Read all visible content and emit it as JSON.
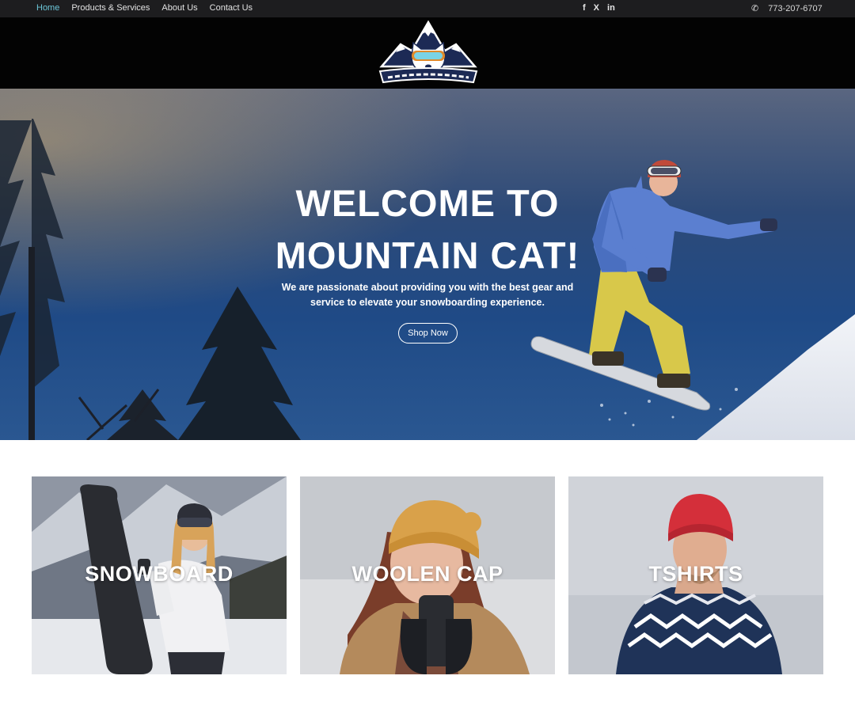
{
  "nav": {
    "items": [
      {
        "label": "Home",
        "active": true
      },
      {
        "label": "Products & Services",
        "active": false
      },
      {
        "label": "About Us",
        "active": false
      },
      {
        "label": "Contact Us",
        "active": false
      }
    ]
  },
  "social": {
    "facebook": "f",
    "x": "X",
    "linkedin": "in"
  },
  "contact": {
    "phone": "773-207-6707"
  },
  "hero": {
    "title_line1": "WELCOME TO",
    "title_line2": "MOUNTAIN CAT!",
    "subtitle_line1": "We are passionate about providing you with the best gear and",
    "subtitle_line2": "service to elevate your snowboarding experience.",
    "cta_label": "Shop Now"
  },
  "categories": [
    {
      "label": "SNOWBOARD"
    },
    {
      "label": "WOOLEN CAP"
    },
    {
      "label": "TSHIRTS"
    }
  ],
  "colors": {
    "active_nav": "#6cc6d8",
    "topbar_bg": "#1d1d1f",
    "logobar_bg": "#030303"
  }
}
